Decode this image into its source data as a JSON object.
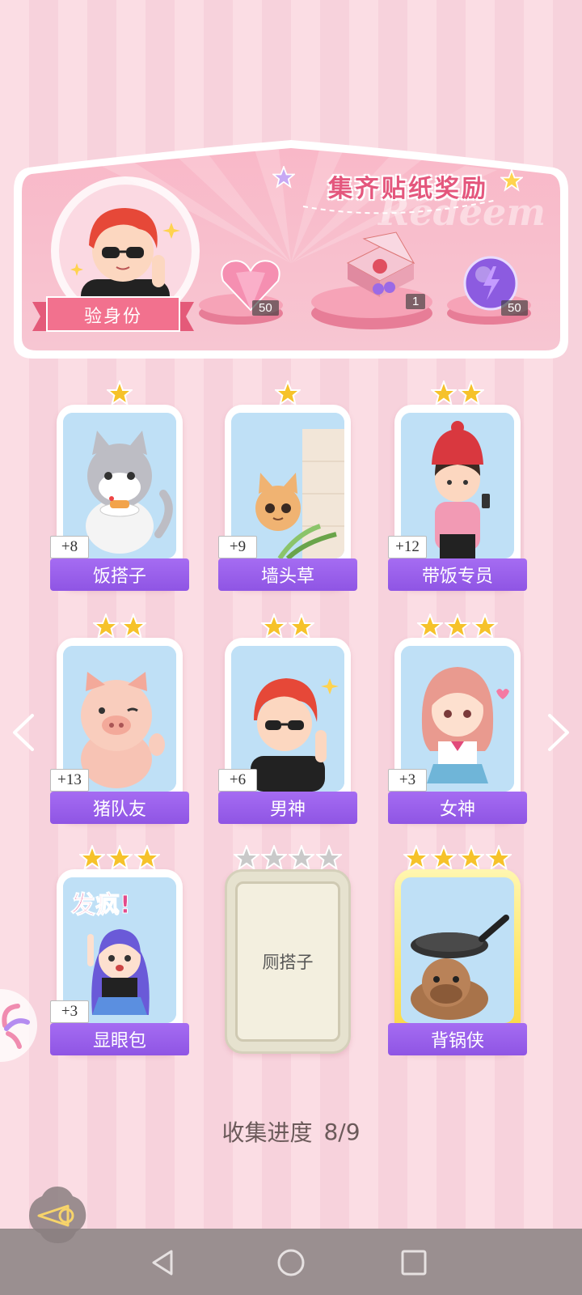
{
  "banner": {
    "title": "集齐贴纸奖励",
    "watermark": "Redeem",
    "identity_label": "验身份",
    "rewards": [
      {
        "icon": "pink-heart-gem-icon",
        "count": "50"
      },
      {
        "icon": "gift-box-icon",
        "count": "1"
      },
      {
        "icon": "purple-energy-orb-icon",
        "count": "50"
      }
    ]
  },
  "cards": [
    {
      "name": "饭搭子",
      "bonus": "+8",
      "stars": 1,
      "state": "owned",
      "art": "cat-eating-icon"
    },
    {
      "name": "墙头草",
      "bonus": "+9",
      "stars": 1,
      "state": "owned",
      "art": "cat-peeking-icon"
    },
    {
      "name": "带饭专员",
      "bonus": "+12",
      "stars": 2,
      "state": "owned",
      "art": "girl-with-beanie-icon"
    },
    {
      "name": "猪队友",
      "bonus": "+13",
      "stars": 2,
      "state": "owned",
      "art": "pig-icon"
    },
    {
      "name": "男神",
      "bonus": "+6",
      "stars": 2,
      "state": "owned",
      "art": "boy-sunglasses-icon"
    },
    {
      "name": "女神",
      "bonus": "+3",
      "stars": 3,
      "state": "owned",
      "art": "girl-schoolgirl-icon"
    },
    {
      "name": "显眼包",
      "bonus": "+3",
      "stars": 3,
      "state": "owned",
      "art": "girl-crazy-icon",
      "art_text": "发疯!"
    },
    {
      "name": "厕搭子",
      "bonus": "",
      "stars": 4,
      "state": "locked",
      "art": ""
    },
    {
      "name": "背锅侠",
      "bonus": "",
      "stars": 4,
      "state": "gold",
      "art": "capybara-pan-icon"
    }
  ],
  "progress": {
    "label": "收集进度",
    "value": "8/9"
  },
  "colors": {
    "accent_pink": "#e4577d",
    "name_bar_purple": "#9b60ec",
    "star_gold": "#f6c22a",
    "star_gray": "#c9c9c9"
  }
}
